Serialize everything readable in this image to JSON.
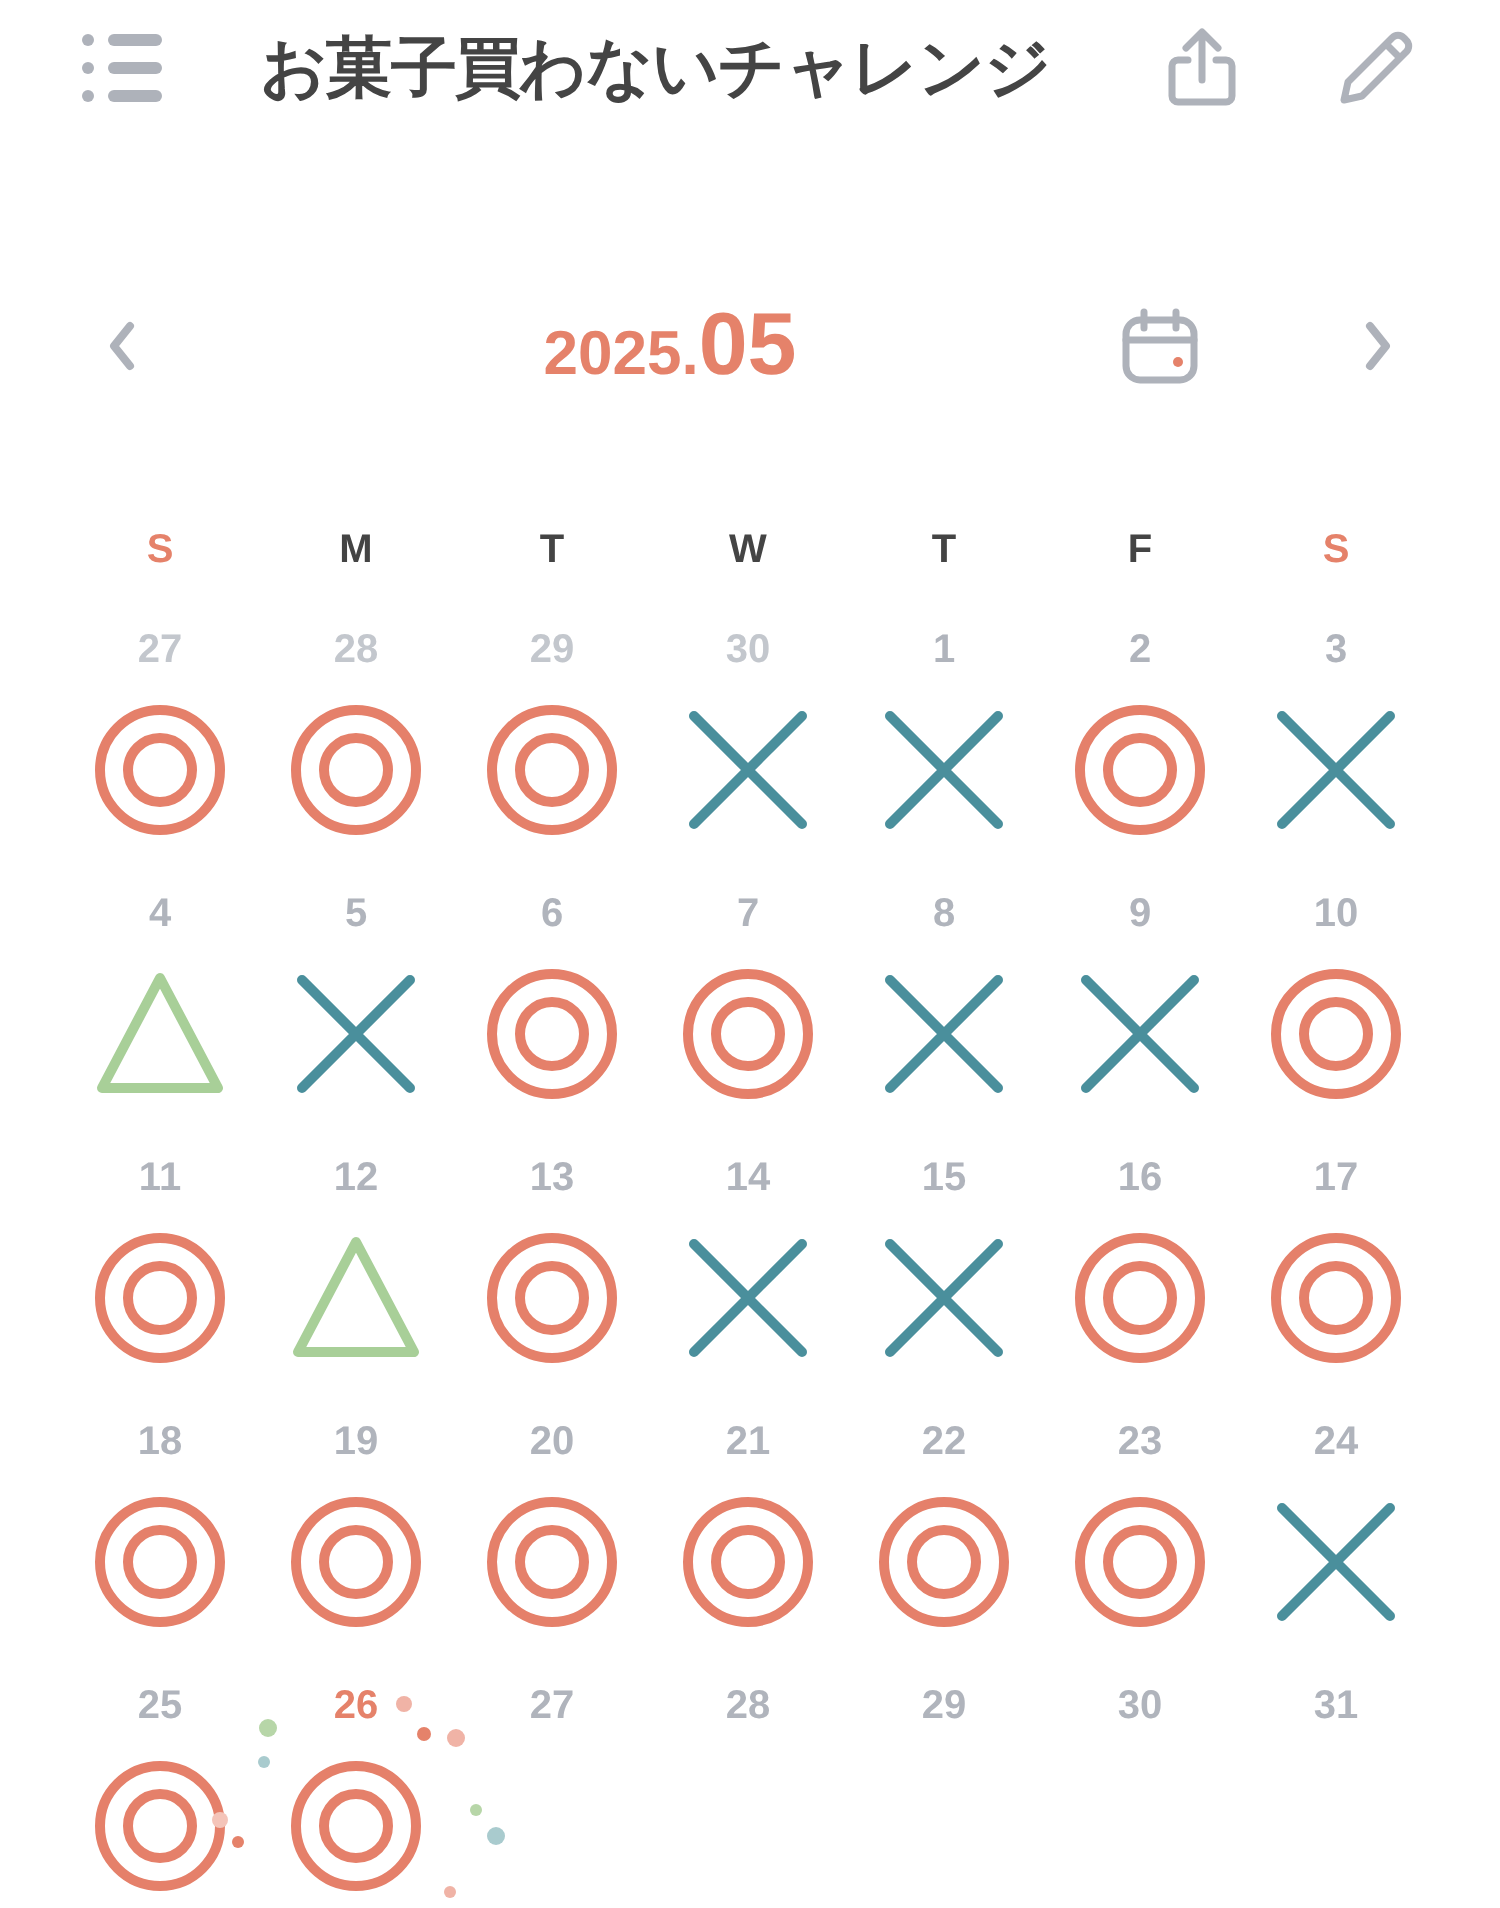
{
  "header": {
    "title": "お菓子買わないチャレンジ"
  },
  "month_nav": {
    "year": "2025.",
    "month": "05"
  },
  "weekdays": [
    {
      "label": "S",
      "weekend": true
    },
    {
      "label": "M",
      "weekend": false
    },
    {
      "label": "T",
      "weekend": false
    },
    {
      "label": "W",
      "weekend": false
    },
    {
      "label": "T",
      "weekend": false
    },
    {
      "label": "F",
      "weekend": false
    },
    {
      "label": "S",
      "weekend": true
    }
  ],
  "weeks": [
    [
      {
        "day": "27",
        "muted": true,
        "today": false,
        "kind": "double_circle"
      },
      {
        "day": "28",
        "muted": true,
        "today": false,
        "kind": "double_circle"
      },
      {
        "day": "29",
        "muted": true,
        "today": false,
        "kind": "double_circle"
      },
      {
        "day": "30",
        "muted": true,
        "today": false,
        "kind": "cross"
      },
      {
        "day": "1",
        "muted": false,
        "today": false,
        "kind": "cross"
      },
      {
        "day": "2",
        "muted": false,
        "today": false,
        "kind": "double_circle"
      },
      {
        "day": "3",
        "muted": false,
        "today": false,
        "kind": "cross"
      }
    ],
    [
      {
        "day": "4",
        "muted": false,
        "today": false,
        "kind": "triangle"
      },
      {
        "day": "5",
        "muted": false,
        "today": false,
        "kind": "cross"
      },
      {
        "day": "6",
        "muted": false,
        "today": false,
        "kind": "double_circle"
      },
      {
        "day": "7",
        "muted": false,
        "today": false,
        "kind": "double_circle"
      },
      {
        "day": "8",
        "muted": false,
        "today": false,
        "kind": "cross"
      },
      {
        "day": "9",
        "muted": false,
        "today": false,
        "kind": "cross"
      },
      {
        "day": "10",
        "muted": false,
        "today": false,
        "kind": "double_circle"
      }
    ],
    [
      {
        "day": "11",
        "muted": false,
        "today": false,
        "kind": "double_circle"
      },
      {
        "day": "12",
        "muted": false,
        "today": false,
        "kind": "triangle"
      },
      {
        "day": "13",
        "muted": false,
        "today": false,
        "kind": "double_circle"
      },
      {
        "day": "14",
        "muted": false,
        "today": false,
        "kind": "cross"
      },
      {
        "day": "15",
        "muted": false,
        "today": false,
        "kind": "cross"
      },
      {
        "day": "16",
        "muted": false,
        "today": false,
        "kind": "double_circle"
      },
      {
        "day": "17",
        "muted": false,
        "today": false,
        "kind": "double_circle"
      }
    ],
    [
      {
        "day": "18",
        "muted": false,
        "today": false,
        "kind": "double_circle"
      },
      {
        "day": "19",
        "muted": false,
        "today": false,
        "kind": "double_circle"
      },
      {
        "day": "20",
        "muted": false,
        "today": false,
        "kind": "double_circle"
      },
      {
        "day": "21",
        "muted": false,
        "today": false,
        "kind": "double_circle"
      },
      {
        "day": "22",
        "muted": false,
        "today": false,
        "kind": "double_circle"
      },
      {
        "day": "23",
        "muted": false,
        "today": false,
        "kind": "double_circle"
      },
      {
        "day": "24",
        "muted": false,
        "today": false,
        "kind": "cross"
      }
    ],
    [
      {
        "day": "25",
        "muted": false,
        "today": false,
        "kind": "double_circle"
      },
      {
        "day": "26",
        "muted": false,
        "today": true,
        "kind": "double_circle"
      },
      {
        "day": "27",
        "muted": false,
        "today": false,
        "kind": "empty"
      },
      {
        "day": "28",
        "muted": false,
        "today": false,
        "kind": "empty"
      },
      {
        "day": "29",
        "muted": false,
        "today": false,
        "kind": "empty"
      },
      {
        "day": "30",
        "muted": false,
        "today": false,
        "kind": "empty"
      },
      {
        "day": "31",
        "muted": false,
        "today": false,
        "kind": "empty"
      }
    ]
  ]
}
